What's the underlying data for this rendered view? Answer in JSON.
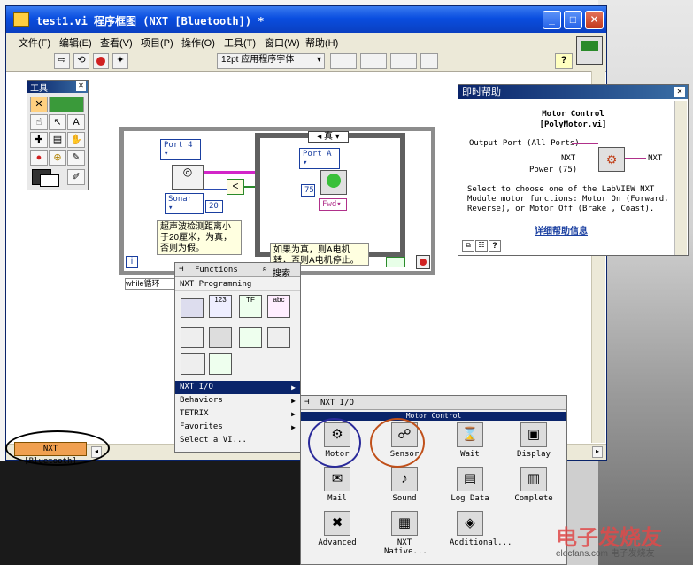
{
  "window": {
    "title": "test1.vi 程序框图 (NXT [Bluetooth]) *",
    "min": "_",
    "max": "□",
    "close": "✕"
  },
  "menubar": [
    "文件(F)",
    "编辑(E)",
    "查看(V)",
    "项目(P)",
    "操作(O)",
    "工具(T)",
    "窗口(W)",
    "帮助(H)"
  ],
  "toolbar": {
    "font_selector": "12pt 应用程序字体"
  },
  "tools_palette": {
    "title": "工具"
  },
  "diagram": {
    "port_input": "Port 4",
    "sonar_node": "Sonar",
    "constant_20": "20",
    "case_selector": "真",
    "motor_port": "Port A",
    "power_75": "75",
    "fwd": "Fwd",
    "comment_sonar": "超声波检测距离小于20厘米，为真，否则为假。",
    "comment_motor": "如果为真，则A电机转，否则A电机停止。",
    "while_label": "while循环",
    "loop_counter": "i"
  },
  "help": {
    "title": "即时帮助",
    "vi_name": "Motor Control",
    "vi_file": "[PolyMotor.vi]",
    "terminal_output_port": "Output Port (All Ports)",
    "terminal_nxt_in": "NXT",
    "terminal_nxt_out": "NXT",
    "terminal_power": "Power (75)",
    "description": "Select to choose one of the LabVIEW NXT Module motor functions: Motor On (Forward, Reverse), or Motor Off (Brake , Coast).",
    "detail_link": "详细帮助信息"
  },
  "functions_palette": {
    "title": "Functions",
    "search": "搜索",
    "category": "NXT Programming",
    "items": [
      "NXT I/O",
      "Behaviors",
      "TETRIX",
      "Favorites",
      "Select a VI..."
    ]
  },
  "nxtio_palette": {
    "title": "NXT I/O",
    "section": "Motor Control",
    "items": [
      {
        "label": "Motor",
        "icon": "motor-icon",
        "glyph": "⚙"
      },
      {
        "label": "Sensor",
        "icon": "sensor-icon",
        "glyph": "☍"
      },
      {
        "label": "Wait",
        "icon": "wait-icon",
        "glyph": "⌛"
      },
      {
        "label": "Display",
        "icon": "display-icon",
        "glyph": "▣"
      },
      {
        "label": "Mail",
        "icon": "mail-icon",
        "glyph": "✉"
      },
      {
        "label": "Sound",
        "icon": "sound-icon",
        "glyph": "♪"
      },
      {
        "label": "Log Data",
        "icon": "log-data-icon",
        "glyph": "▤"
      },
      {
        "label": "Complete",
        "icon": "complete-icon",
        "glyph": "▥"
      },
      {
        "label": "Advanced",
        "icon": "advanced-icon",
        "glyph": "✖"
      },
      {
        "label": "NXT Native...",
        "icon": "nxt-native-icon",
        "glyph": "▦"
      },
      {
        "label": "Additional...",
        "icon": "additional-icon",
        "glyph": "◈"
      }
    ]
  },
  "status_target": "NXT [Bluetooth]",
  "watermark": {
    "main": "电子发烧友",
    "sub": "elecfans.com 电子发烧友"
  },
  "colors": {
    "titlebar": "#0a4ee0",
    "wire_pink": "#d226c8",
    "selection": "#0a246a"
  }
}
